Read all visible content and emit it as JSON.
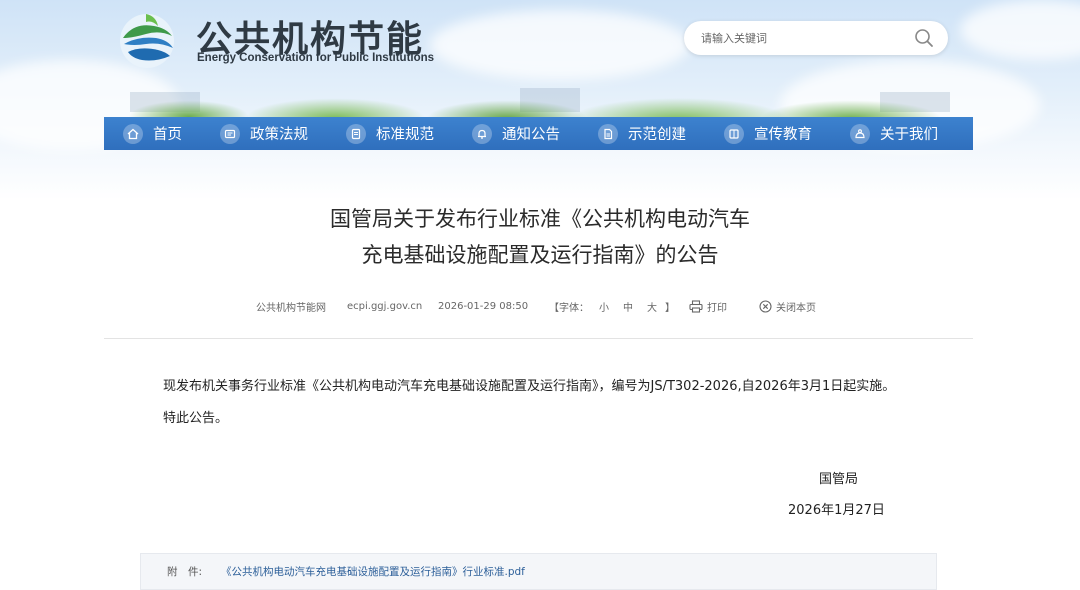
{
  "site": {
    "title": "公共机构节能",
    "subtitle": "Energy Conservation for Public Institutions"
  },
  "search": {
    "placeholder": "请输入关键词"
  },
  "nav": {
    "items": [
      {
        "label": "首页",
        "icon": "home-icon"
      },
      {
        "label": "政策法规",
        "icon": "policy-icon"
      },
      {
        "label": "标准规范",
        "icon": "standard-icon"
      },
      {
        "label": "通知公告",
        "icon": "bell-icon"
      },
      {
        "label": "示范创建",
        "icon": "document-icon"
      },
      {
        "label": "宣传教育",
        "icon": "book-icon"
      },
      {
        "label": "关于我们",
        "icon": "info-icon"
      }
    ]
  },
  "article": {
    "title_line1": "国管局关于发布行业标准《公共机构电动汽车",
    "title_line2": "充电基础设施配置及运行指南》的公告",
    "source": "公共机构节能网",
    "domain": "ecpi.ggj.gov.cn",
    "datetime": "2026-01-29 08:50",
    "font_label": "【字体：",
    "font_small": "小",
    "font_medium": "中",
    "font_large": "大",
    "font_close": "】",
    "print_label": "打印",
    "close_label": "关闭本页",
    "paragraph1": "现发布机关事务行业标准《公共机构电动汽车充电基础设施配置及运行指南》，编号为JS/T302-2026,自2026年3月1日起实施。",
    "paragraph2": "特此公告。",
    "signer": "国管局",
    "sign_date": "2026年1月27日"
  },
  "attachment": {
    "label": "附　件:",
    "file": "《公共机构电动汽车充电基础设施配置及运行指南》行业标准.pdf"
  },
  "colors": {
    "nav_bg": "#3478c6",
    "link": "#2c5f99"
  }
}
